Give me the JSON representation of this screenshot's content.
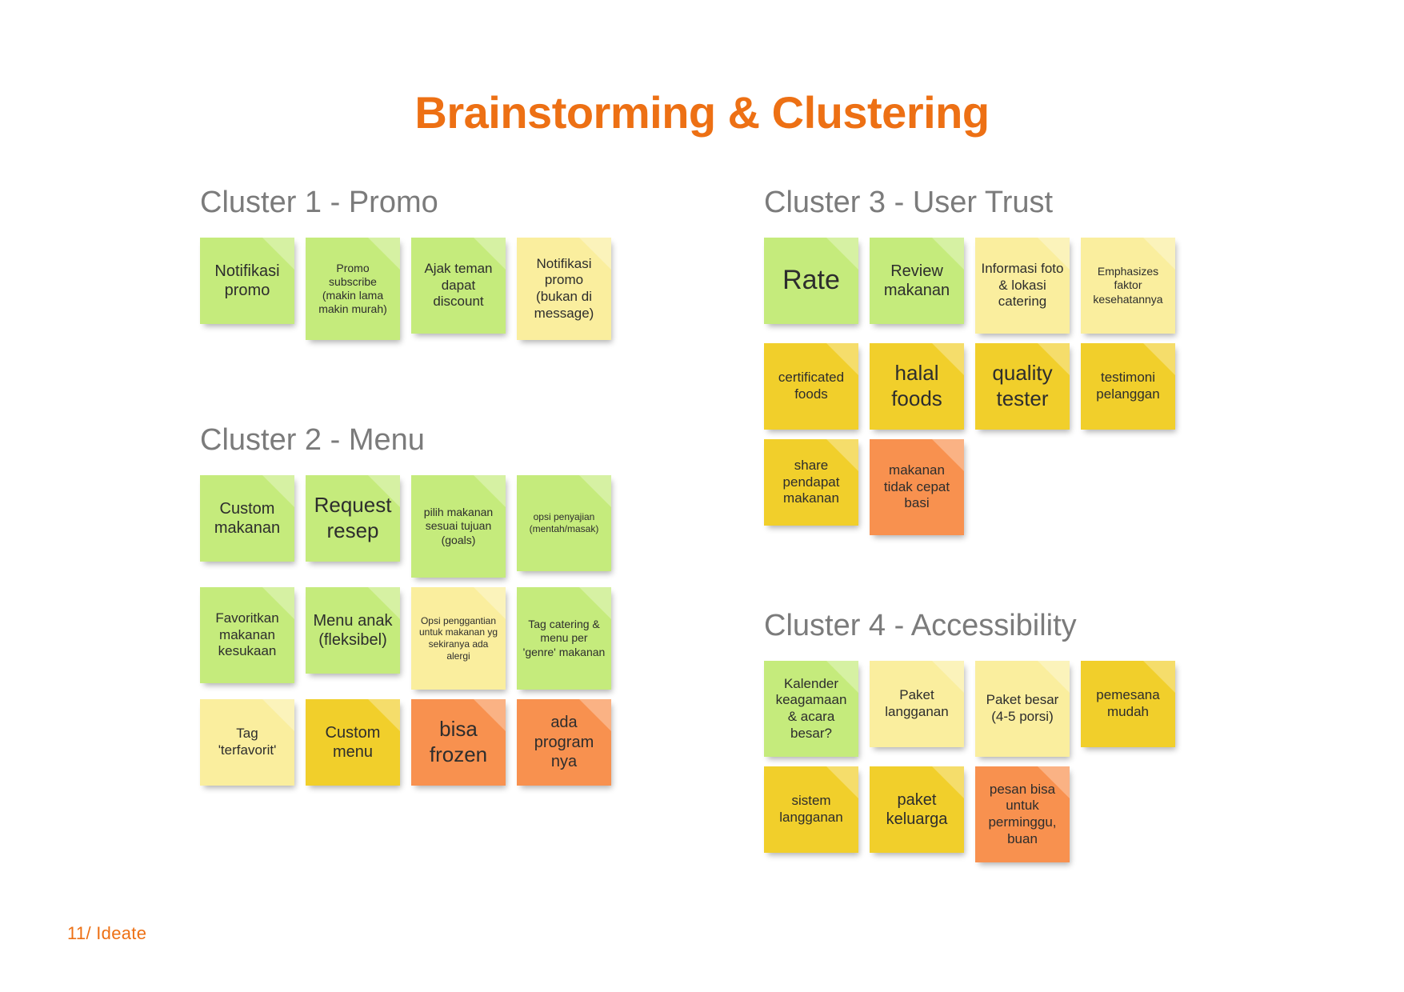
{
  "slide": {
    "title": "Brainstorming & Clustering",
    "footer": "11/ Ideate",
    "accent_color": "#ED7014",
    "heading_color": "#7b7b7b"
  },
  "palette": {
    "green": "#c5eb7c",
    "cream": "#faee9e",
    "gold": "#f1cf2b",
    "orange": "#f8914f"
  },
  "clusters": [
    {
      "id": "cluster-1",
      "title": "Cluster 1 - Promo",
      "rows": [
        [
          {
            "text": "Notifikasi promo",
            "color": "green",
            "size": "lg"
          },
          {
            "text": "Promo subscribe (makin lama makin murah)",
            "color": "green",
            "size": "sm"
          },
          {
            "text": "Ajak teman dapat discount",
            "color": "green",
            "size": "md"
          },
          {
            "text": "Notifikasi promo (bukan di message)",
            "color": "cream",
            "size": "md"
          }
        ]
      ]
    },
    {
      "id": "cluster-2",
      "title": "Cluster 2 - Menu",
      "rows": [
        [
          {
            "text": "Custom makanan",
            "color": "green",
            "size": "lg"
          },
          {
            "text": "Request resep",
            "color": "green",
            "size": "xl"
          },
          {
            "text": "pilih makanan sesuai tujuan (goals)",
            "color": "green",
            "size": "sm"
          },
          {
            "text": "opsi penyajian (mentah/masak)",
            "color": "green",
            "size": "xs"
          }
        ],
        [
          {
            "text": "Favoritkan makanan kesukaan",
            "color": "green",
            "size": "md"
          },
          {
            "text": "Menu anak (fleksibel)",
            "color": "green",
            "size": "lg"
          },
          {
            "text": "Opsi penggantian untuk makanan yg sekiranya ada alergi",
            "color": "cream",
            "size": "xs"
          },
          {
            "text": "Tag catering & menu per 'genre' makanan",
            "color": "green",
            "size": "sm"
          }
        ],
        [
          {
            "text": "Tag 'terfavorit'",
            "color": "cream",
            "size": "md"
          },
          {
            "text": "Custom menu",
            "color": "gold",
            "size": "lg"
          },
          {
            "text": "bisa frozen",
            "color": "orange",
            "size": "xl"
          },
          {
            "text": "ada program nya",
            "color": "orange",
            "size": "lg"
          }
        ]
      ]
    },
    {
      "id": "cluster-3",
      "title": "Cluster 3 - User Trust",
      "rows": [
        [
          {
            "text": "Rate",
            "color": "green",
            "size": "xxl"
          },
          {
            "text": "Review makanan",
            "color": "green",
            "size": "lg"
          },
          {
            "text": "Informasi foto & lokasi catering",
            "color": "cream",
            "size": "md"
          },
          {
            "text": "Emphasizes faktor kesehatannya",
            "color": "cream",
            "size": "sm"
          }
        ],
        [
          {
            "text": "certificated foods",
            "color": "gold",
            "size": "md"
          },
          {
            "text": "halal foods",
            "color": "gold",
            "size": "xl"
          },
          {
            "text": "quality tester",
            "color": "gold",
            "size": "xl"
          },
          {
            "text": "testimoni pelanggan",
            "color": "gold",
            "size": "md"
          }
        ],
        [
          {
            "text": "share pendapat makanan",
            "color": "gold",
            "size": "md"
          },
          {
            "text": "makanan tidak cepat basi",
            "color": "orange",
            "size": "md"
          }
        ]
      ]
    },
    {
      "id": "cluster-4",
      "title": "Cluster 4 - Accessibility",
      "rows": [
        [
          {
            "text": "Kalender keagamaan & acara besar?",
            "color": "green",
            "size": "md"
          },
          {
            "text": "Paket langganan",
            "color": "cream",
            "size": "md"
          },
          {
            "text": "Paket besar (4-5 porsi)",
            "color": "cream",
            "size": "md"
          },
          {
            "text": "pemesana mudah",
            "color": "gold",
            "size": "md"
          }
        ],
        [
          {
            "text": "sistem langganan",
            "color": "gold",
            "size": "md"
          },
          {
            "text": "paket keluarga",
            "color": "gold",
            "size": "lg"
          },
          {
            "text": "pesan bisa untuk perminggu, buan",
            "color": "orange",
            "size": "md"
          }
        ]
      ]
    }
  ]
}
